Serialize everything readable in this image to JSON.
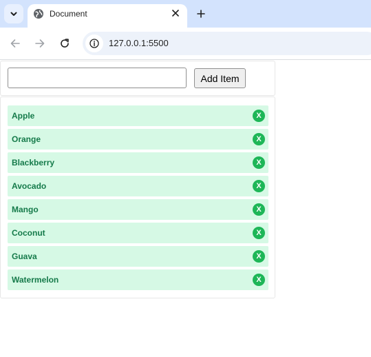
{
  "browser": {
    "tab_title": "Document",
    "url": "127.0.0.1:5500"
  },
  "form": {
    "input_value": "",
    "input_placeholder": "",
    "add_button_label": "Add Item"
  },
  "items": [
    {
      "label": "Apple",
      "delete_label": "X"
    },
    {
      "label": "Orange",
      "delete_label": "X"
    },
    {
      "label": "Blackberry",
      "delete_label": "X"
    },
    {
      "label": "Avocado",
      "delete_label": "X"
    },
    {
      "label": "Mango",
      "delete_label": "X"
    },
    {
      "label": "Coconut",
      "delete_label": "X"
    },
    {
      "label": "Guava",
      "delete_label": "X"
    },
    {
      "label": "Watermelon",
      "delete_label": "X"
    }
  ],
  "colors": {
    "item_background": "#d6f9e5",
    "item_text": "#157a4a",
    "delete_button": "#1db657"
  },
  "icons": {
    "tab_list": "chevron-down-icon",
    "favicon": "globe-icon",
    "tab_close": "close-icon",
    "new_tab": "plus-icon",
    "back": "arrow-left-icon",
    "forward": "arrow-right-icon",
    "reload": "reload-icon",
    "site_info": "info-icon"
  }
}
